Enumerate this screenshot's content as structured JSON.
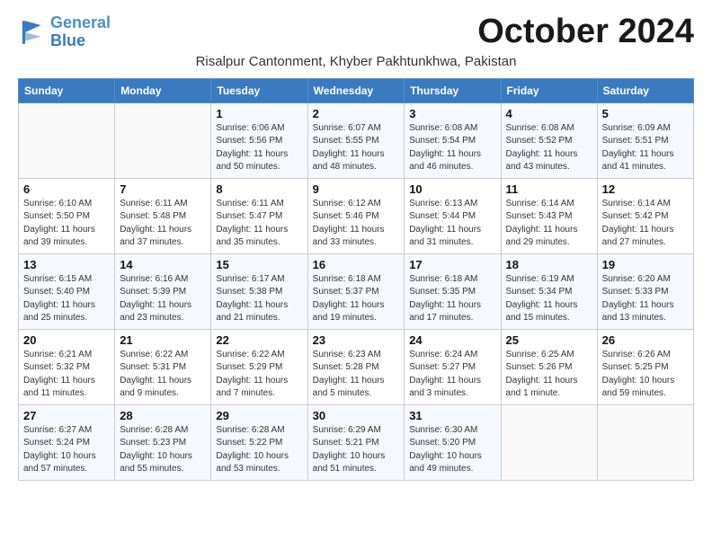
{
  "header": {
    "logo_line1": "General",
    "logo_line2": "Blue",
    "month_title": "October 2024",
    "location": "Risalpur Cantonment, Khyber Pakhtunkhwa, Pakistan"
  },
  "days_of_week": [
    "Sunday",
    "Monday",
    "Tuesday",
    "Wednesday",
    "Thursday",
    "Friday",
    "Saturday"
  ],
  "weeks": [
    [
      {
        "day": "",
        "info": ""
      },
      {
        "day": "",
        "info": ""
      },
      {
        "day": "1",
        "info": "Sunrise: 6:06 AM\nSunset: 5:56 PM\nDaylight: 11 hours and 50 minutes."
      },
      {
        "day": "2",
        "info": "Sunrise: 6:07 AM\nSunset: 5:55 PM\nDaylight: 11 hours and 48 minutes."
      },
      {
        "day": "3",
        "info": "Sunrise: 6:08 AM\nSunset: 5:54 PM\nDaylight: 11 hours and 46 minutes."
      },
      {
        "day": "4",
        "info": "Sunrise: 6:08 AM\nSunset: 5:52 PM\nDaylight: 11 hours and 43 minutes."
      },
      {
        "day": "5",
        "info": "Sunrise: 6:09 AM\nSunset: 5:51 PM\nDaylight: 11 hours and 41 minutes."
      }
    ],
    [
      {
        "day": "6",
        "info": "Sunrise: 6:10 AM\nSunset: 5:50 PM\nDaylight: 11 hours and 39 minutes."
      },
      {
        "day": "7",
        "info": "Sunrise: 6:11 AM\nSunset: 5:48 PM\nDaylight: 11 hours and 37 minutes."
      },
      {
        "day": "8",
        "info": "Sunrise: 6:11 AM\nSunset: 5:47 PM\nDaylight: 11 hours and 35 minutes."
      },
      {
        "day": "9",
        "info": "Sunrise: 6:12 AM\nSunset: 5:46 PM\nDaylight: 11 hours and 33 minutes."
      },
      {
        "day": "10",
        "info": "Sunrise: 6:13 AM\nSunset: 5:44 PM\nDaylight: 11 hours and 31 minutes."
      },
      {
        "day": "11",
        "info": "Sunrise: 6:14 AM\nSunset: 5:43 PM\nDaylight: 11 hours and 29 minutes."
      },
      {
        "day": "12",
        "info": "Sunrise: 6:14 AM\nSunset: 5:42 PM\nDaylight: 11 hours and 27 minutes."
      }
    ],
    [
      {
        "day": "13",
        "info": "Sunrise: 6:15 AM\nSunset: 5:40 PM\nDaylight: 11 hours and 25 minutes."
      },
      {
        "day": "14",
        "info": "Sunrise: 6:16 AM\nSunset: 5:39 PM\nDaylight: 11 hours and 23 minutes."
      },
      {
        "day": "15",
        "info": "Sunrise: 6:17 AM\nSunset: 5:38 PM\nDaylight: 11 hours and 21 minutes."
      },
      {
        "day": "16",
        "info": "Sunrise: 6:18 AM\nSunset: 5:37 PM\nDaylight: 11 hours and 19 minutes."
      },
      {
        "day": "17",
        "info": "Sunrise: 6:18 AM\nSunset: 5:35 PM\nDaylight: 11 hours and 17 minutes."
      },
      {
        "day": "18",
        "info": "Sunrise: 6:19 AM\nSunset: 5:34 PM\nDaylight: 11 hours and 15 minutes."
      },
      {
        "day": "19",
        "info": "Sunrise: 6:20 AM\nSunset: 5:33 PM\nDaylight: 11 hours and 13 minutes."
      }
    ],
    [
      {
        "day": "20",
        "info": "Sunrise: 6:21 AM\nSunset: 5:32 PM\nDaylight: 11 hours and 11 minutes."
      },
      {
        "day": "21",
        "info": "Sunrise: 6:22 AM\nSunset: 5:31 PM\nDaylight: 11 hours and 9 minutes."
      },
      {
        "day": "22",
        "info": "Sunrise: 6:22 AM\nSunset: 5:29 PM\nDaylight: 11 hours and 7 minutes."
      },
      {
        "day": "23",
        "info": "Sunrise: 6:23 AM\nSunset: 5:28 PM\nDaylight: 11 hours and 5 minutes."
      },
      {
        "day": "24",
        "info": "Sunrise: 6:24 AM\nSunset: 5:27 PM\nDaylight: 11 hours and 3 minutes."
      },
      {
        "day": "25",
        "info": "Sunrise: 6:25 AM\nSunset: 5:26 PM\nDaylight: 11 hours and 1 minute."
      },
      {
        "day": "26",
        "info": "Sunrise: 6:26 AM\nSunset: 5:25 PM\nDaylight: 10 hours and 59 minutes."
      }
    ],
    [
      {
        "day": "27",
        "info": "Sunrise: 6:27 AM\nSunset: 5:24 PM\nDaylight: 10 hours and 57 minutes."
      },
      {
        "day": "28",
        "info": "Sunrise: 6:28 AM\nSunset: 5:23 PM\nDaylight: 10 hours and 55 minutes."
      },
      {
        "day": "29",
        "info": "Sunrise: 6:28 AM\nSunset: 5:22 PM\nDaylight: 10 hours and 53 minutes."
      },
      {
        "day": "30",
        "info": "Sunrise: 6:29 AM\nSunset: 5:21 PM\nDaylight: 10 hours and 51 minutes."
      },
      {
        "day": "31",
        "info": "Sunrise: 6:30 AM\nSunset: 5:20 PM\nDaylight: 10 hours and 49 minutes."
      },
      {
        "day": "",
        "info": ""
      },
      {
        "day": "",
        "info": ""
      }
    ]
  ]
}
